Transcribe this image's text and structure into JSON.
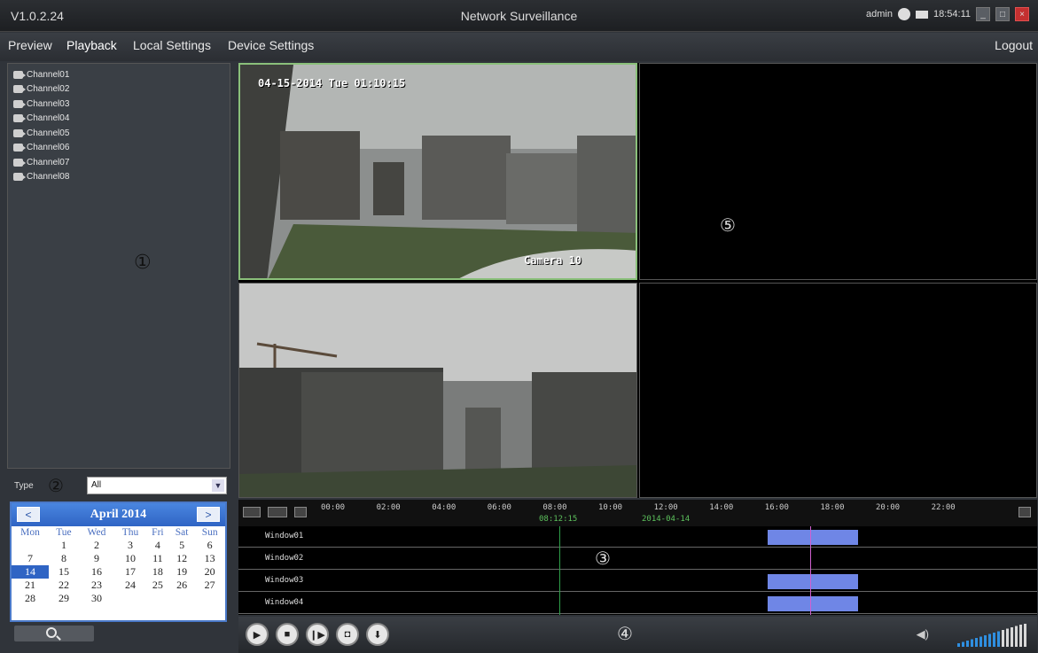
{
  "titlebar": {
    "version": "V1.0.2.24",
    "title": "Network Surveillance",
    "user": "admin",
    "time": "18:54:11"
  },
  "menu": {
    "preview": "Preview",
    "playback": "Playback",
    "local": "Local Settings",
    "device": "Device Settings",
    "logout": "Logout"
  },
  "channels": [
    "Channel01",
    "Channel02",
    "Channel03",
    "Channel04",
    "Channel05",
    "Channel06",
    "Channel07",
    "Channel08"
  ],
  "markers": {
    "m1": "①",
    "m2": "②",
    "m3": "③",
    "m4": "④",
    "m5": "⑤"
  },
  "type": {
    "label": "Type",
    "value": "All"
  },
  "calendar": {
    "month": "April 2014",
    "prev": "<",
    "next": ">",
    "days": [
      "Mon",
      "Tue",
      "Wed",
      "Thu",
      "Fri",
      "Sat",
      "Sun"
    ],
    "weeks": [
      [
        "",
        "1",
        "2",
        "3",
        "4",
        "5",
        "6"
      ],
      [
        "7",
        "8",
        "9",
        "10",
        "11",
        "12",
        "13"
      ],
      [
        "14",
        "15",
        "16",
        "17",
        "18",
        "19",
        "20"
      ],
      [
        "21",
        "22",
        "23",
        "24",
        "25",
        "26",
        "27"
      ],
      [
        "28",
        "29",
        "30",
        "",
        "",
        "",
        ""
      ]
    ],
    "selected": "14"
  },
  "video": {
    "cam1_datetime": "04-15-2014 Tue 01:10:15",
    "cam1_name": "Camera 10"
  },
  "timeline": {
    "ticks": [
      "00:00",
      "02:00",
      "04:00",
      "06:00",
      "08:00",
      "10:00",
      "12:00",
      "14:00",
      "16:00",
      "18:00",
      "20:00",
      "22:00"
    ],
    "cursor_time": "08:12:15",
    "date": "2014-04-14",
    "windows": [
      "Window01",
      "Window02",
      "Window03",
      "Window04"
    ]
  }
}
